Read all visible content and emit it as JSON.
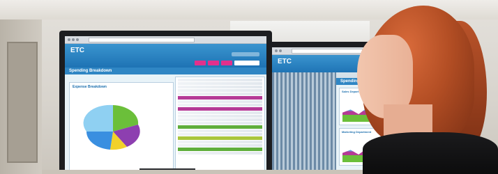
{
  "monitor1": {
    "logo": "ETC",
    "section_title": "Spending Breakdown",
    "chart_title": "Expense Breakdown"
  },
  "monitor2": {
    "logo": "ETC",
    "section_title": "Spending Repo",
    "card1_title": "Sales Depart",
    "card2_title": "Marketing Department"
  },
  "colors": {
    "brand_blue": "#1e73b4",
    "accent_pink": "#e2308c",
    "hair": "#b34e24"
  }
}
